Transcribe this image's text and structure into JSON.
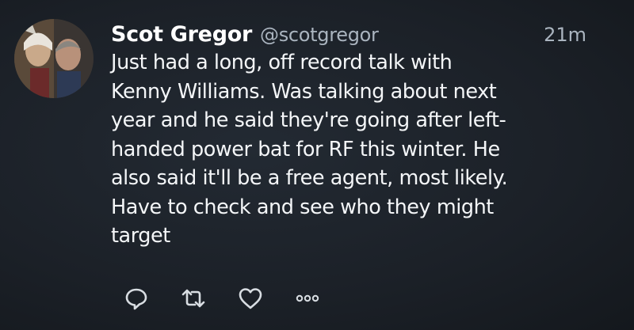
{
  "tweet": {
    "display_name": "Scot Gregor",
    "handle": "@scotgregor",
    "timestamp": "21m",
    "text": "Just had a long, off record talk with\nKenny Williams. Was talking about next\nyear and he said they're going after left-\nhanded power bat for RF this winter. He\nalso said it'll be a free agent, most likely.\nHave to check and see who they might\ntarget"
  },
  "actions": {
    "reply_icon": "reply-icon",
    "retweet_icon": "retweet-icon",
    "like_icon": "heart-icon",
    "more_icon": "more-icon"
  },
  "colors": {
    "background": "#1b2027",
    "text": "#f4f6f8",
    "secondary_text": "#aab4bf"
  }
}
